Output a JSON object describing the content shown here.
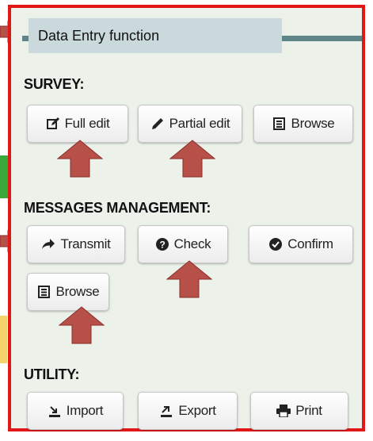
{
  "panel": {
    "title": "Data Entry function",
    "accent_color": "#e21818",
    "header_color": "#5f8588"
  },
  "survey": {
    "label": "SURVEY:",
    "full_edit": {
      "label": "Full edit",
      "icon": "edit-square-icon"
    },
    "partial_edit": {
      "label": "Partial edit",
      "icon": "pencil-icon"
    },
    "browse": {
      "label": "Browse",
      "icon": "list-icon"
    }
  },
  "messages": {
    "label": "MESSAGES MANAGEMENT:",
    "transmit": {
      "label": "Transmit",
      "icon": "share-arrow-icon"
    },
    "check": {
      "label": "Check",
      "icon": "question-circle-icon"
    },
    "confirm": {
      "label": "Confirm",
      "icon": "check-circle-icon"
    },
    "browse": {
      "label": "Browse",
      "icon": "list-icon"
    }
  },
  "utility": {
    "label": "UTILITY:",
    "import": {
      "label": "Import",
      "icon": "import-icon"
    },
    "export": {
      "label": "Export",
      "icon": "export-icon"
    },
    "print": {
      "label": "Print",
      "icon": "print-icon"
    }
  },
  "annotation_arrow_color": "#b8504a"
}
